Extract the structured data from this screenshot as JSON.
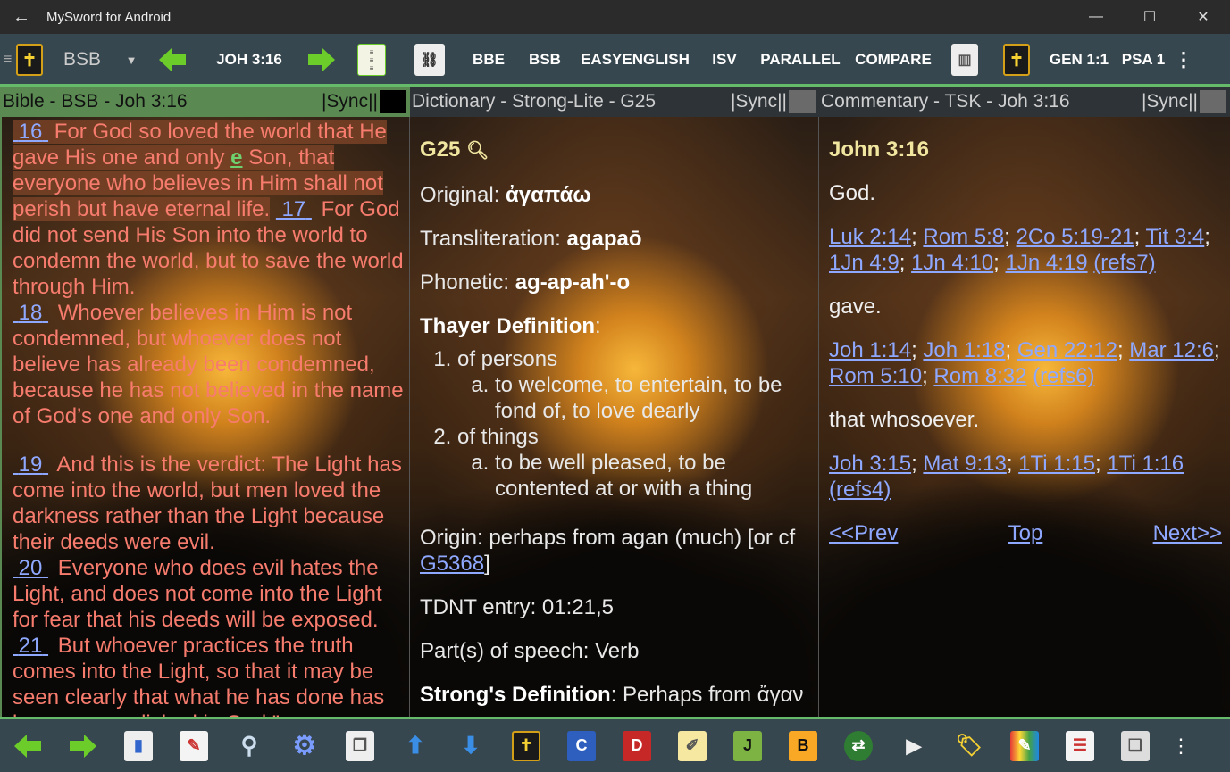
{
  "window": {
    "title": "MySword for Android",
    "minimize": "—",
    "maximize": "☐",
    "close": "✕",
    "back": "←"
  },
  "toolbar": {
    "bible_selector": "BSB",
    "dropdown": "▼",
    "current_ref": "JOH 3:16",
    "tabs": [
      "BBE",
      "BSB",
      "EASYENGLISH",
      "ISV",
      "PARALLEL",
      "COMPARE"
    ],
    "bookmarks": [
      "GEN 1:1",
      "PSA 1"
    ],
    "more": "⋮"
  },
  "panes": {
    "bible": {
      "header": "Bible - BSB - Joh 3:16",
      "sync": "|Sync||",
      "verses": [
        {
          "num": "16",
          "text": "For God so loved the world that He gave His one and only ",
          "strong": "e",
          "text2": " Son, that everyone who believes in Him shall not perish but have eternal life."
        },
        {
          "num": "17",
          "text": "For God did not send His Son into the world to condemn the world, but to save the world through Him."
        },
        {
          "num": "18",
          "text": "Whoever believes in Him is not condemned, but whoever does not believe has already been condemned, because he has not believed in the name of God’s one and only Son."
        },
        {
          "num": "19",
          "text": "And this is the verdict: The Light has come into the world, but men loved the darkness rather than the Light because their deeds were evil."
        },
        {
          "num": "20",
          "text": "Everyone who does evil hates the Light, and does not come into the Light for fear that his deeds will be exposed."
        },
        {
          "num": "21",
          "text": "But whoever practices the truth comes into the Light, so that it may be seen clearly that what he has done has been accomplished in God.”"
        }
      ]
    },
    "dictionary": {
      "header": "Dictionary - Strong-Lite - G25",
      "sync": "|Sync||",
      "entry": "G25",
      "original_label": "Original: ",
      "original": "ἀγαπάω",
      "translit_label": "Transliteration: ",
      "translit": "agapaō",
      "phonetic_label": "Phonetic: ",
      "phonetic": "ag-ap-ah'-o",
      "thayer_label": "Thayer Definition",
      "thayer_colon": ":",
      "def1": "of persons",
      "def1a": "to welcome, to entertain, to be fond of, to love dearly",
      "def2": "of things",
      "def2a": "to be well pleased, to be contented at or with a thing",
      "origin_pre": "Origin: perhaps from agan (much) [or cf ",
      "origin_link": "G5368",
      "origin_post": "]",
      "tdnt": "TDNT entry: 01:21,5",
      "pos": "Part(s) of speech: Verb",
      "strongs_label": "Strong's Definition",
      "strongs_text": ": Perhaps from ἄγαν"
    },
    "commentary": {
      "header": "Commentary - TSK - Joh 3:16",
      "sync": "|Sync||",
      "title": "John 3:16",
      "word1": "God.",
      "refs1": [
        "Luk 2:14",
        "Rom 5:8",
        "2Co 5:19-21",
        "Tit 3:4",
        "1Jn 4:9",
        "1Jn 4:10",
        "1Jn 4:19"
      ],
      "refs1_more": "(refs7)",
      "word2": "gave.",
      "refs2": [
        "Joh 1:14",
        "Joh 1:18",
        "Gen 22:12",
        "Mar 12:6",
        "Rom 5:10",
        "Rom 8:32"
      ],
      "refs2_more": "(refs6)",
      "word3": "that whosoever.",
      "refs3": [
        "Joh 3:15",
        "Mat 9:13",
        "1Ti 1:15",
        "1Ti 1:16"
      ],
      "refs3_more": "(refs4)",
      "prev": "<<Prev",
      "top": "Top",
      "next": "Next>>"
    }
  },
  "bottombar": {
    "more": "⋮",
    "icons": [
      "prev-arrow",
      "next-arrow",
      "bookmark",
      "notes",
      "search",
      "settings",
      "copy",
      "scroll-up",
      "scroll-down",
      "bible",
      "commentary",
      "dictionary",
      "journal",
      "j-book",
      "b-book",
      "sync",
      "play",
      "tag",
      "highlight",
      "list",
      "windows"
    ]
  },
  "colors": {
    "toolbar": "#37474f",
    "accent": "#66bb6a",
    "verse_text": "#f77c6e",
    "link": "#8fa8ff",
    "heading": "#f1e6a0"
  }
}
